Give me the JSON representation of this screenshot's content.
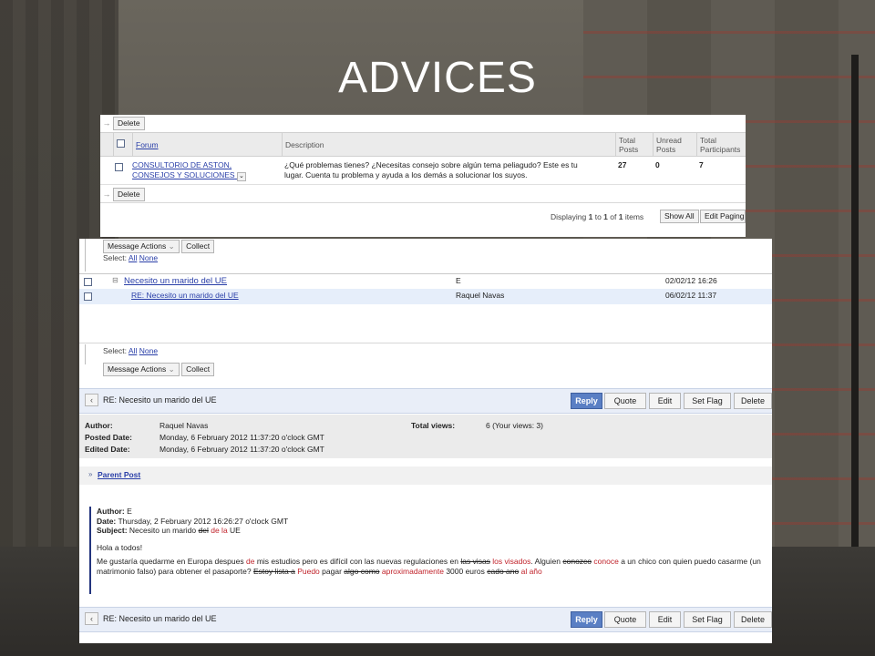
{
  "slide": {
    "title": "ADVICES"
  },
  "forum_panel": {
    "top_delete": "Delete",
    "bottom_delete": "Delete",
    "columns": {
      "forum": "Forum",
      "description": "Description",
      "total_posts": [
        "Total",
        "Posts"
      ],
      "unread_posts": [
        "Unread",
        "Posts"
      ],
      "total_participants": [
        "Total",
        "Participants"
      ]
    },
    "row": {
      "forum_name_line1": "CONSULTORIO DE ASTON,",
      "forum_name_line2": "CONSEJOS Y SOLUCIONES",
      "description_line1": "¿Qué problemas tienes? ¿Necesitas consejo sobre algún tema peliagudo? Este es tu",
      "description_line2": "lugar. Cuenta tu problema y ayuda a los demás a solucionar los suyos.",
      "total_posts": "27",
      "unread_posts": "0",
      "total_participants": "7"
    },
    "footer": {
      "displaying_prefix": "Displaying",
      "from": "1",
      "to_word": "to",
      "to": "1",
      "of_word": "of",
      "total": "1",
      "items_word": "items",
      "show_all": "Show All",
      "edit_paging": "Edit Paging"
    }
  },
  "thread_panel": {
    "top_toolbar": {
      "message_actions": "Message Actions",
      "collect": "Collect",
      "select_label": "Select:",
      "all": "All",
      "none": "None"
    },
    "messages": [
      {
        "subject": "Necesito un marido del UE",
        "author": "E",
        "date": "02/02/12 16:26"
      },
      {
        "subject": "RE: Necesito un marido del UE",
        "author": "Raquel Navas",
        "date": "06/02/12 11:37"
      }
    ],
    "bottom_toolbar": {
      "select_label": "Select:",
      "all": "All",
      "none": "None",
      "message_actions": "Message Actions",
      "collect": "Collect"
    },
    "reader": {
      "subject": "RE: Necesito un marido del UE",
      "buttons": {
        "reply": "Reply",
        "quote": "Quote",
        "edit": "Edit",
        "set_flag": "Set Flag",
        "delete": "Delete"
      },
      "meta": {
        "author_label": "Author:",
        "author": "Raquel Navas",
        "posted_label": "Posted Date:",
        "posted": "Monday, 6 February 2012 11:37:20 o'clock GMT",
        "edited_label": "Edited Date:",
        "edited": "Monday, 6 February 2012 11:37:20 o'clock GMT",
        "views_label": "Total views:",
        "views": "6 (Your views: 3)"
      },
      "parent_post_label": "Parent Post",
      "quoted": {
        "author_label": "Author:",
        "author": "E",
        "date_label": "Date:",
        "date": "Thursday, 2 February 2012 16:26:27 o'clock GMT",
        "subject_label": "Subject:",
        "subject_start": "Necesito un marido",
        "subject_struck": "del",
        "subject_fix": "de la",
        "subject_end": "UE",
        "greeting": "Hola a todos!",
        "body": {
          "t1": "Me gustaría quedarme en Europa despues",
          "r1": "de",
          "t2": "mis estudios pero es difícil con las nuevas regulaciones en",
          "s1": "las visas",
          "r2": "los visados",
          "t3": ". Alguien",
          "s2": "conozco",
          "r3": "conoce",
          "t4": "a un chico con quien",
          "t5": "puedo casarme (un matrimonio falso) para obtener el pasaporte?",
          "s3": "Estoy lista a",
          "r4": "Puedo",
          "t6": "pagar",
          "s4": "algo como",
          "r5": "aproximadamente",
          "t7": "3000 euros",
          "s5": "cado ano",
          "r6": "al año"
        }
      },
      "bottom_subject": "RE: Necesito un marido del UE"
    }
  }
}
